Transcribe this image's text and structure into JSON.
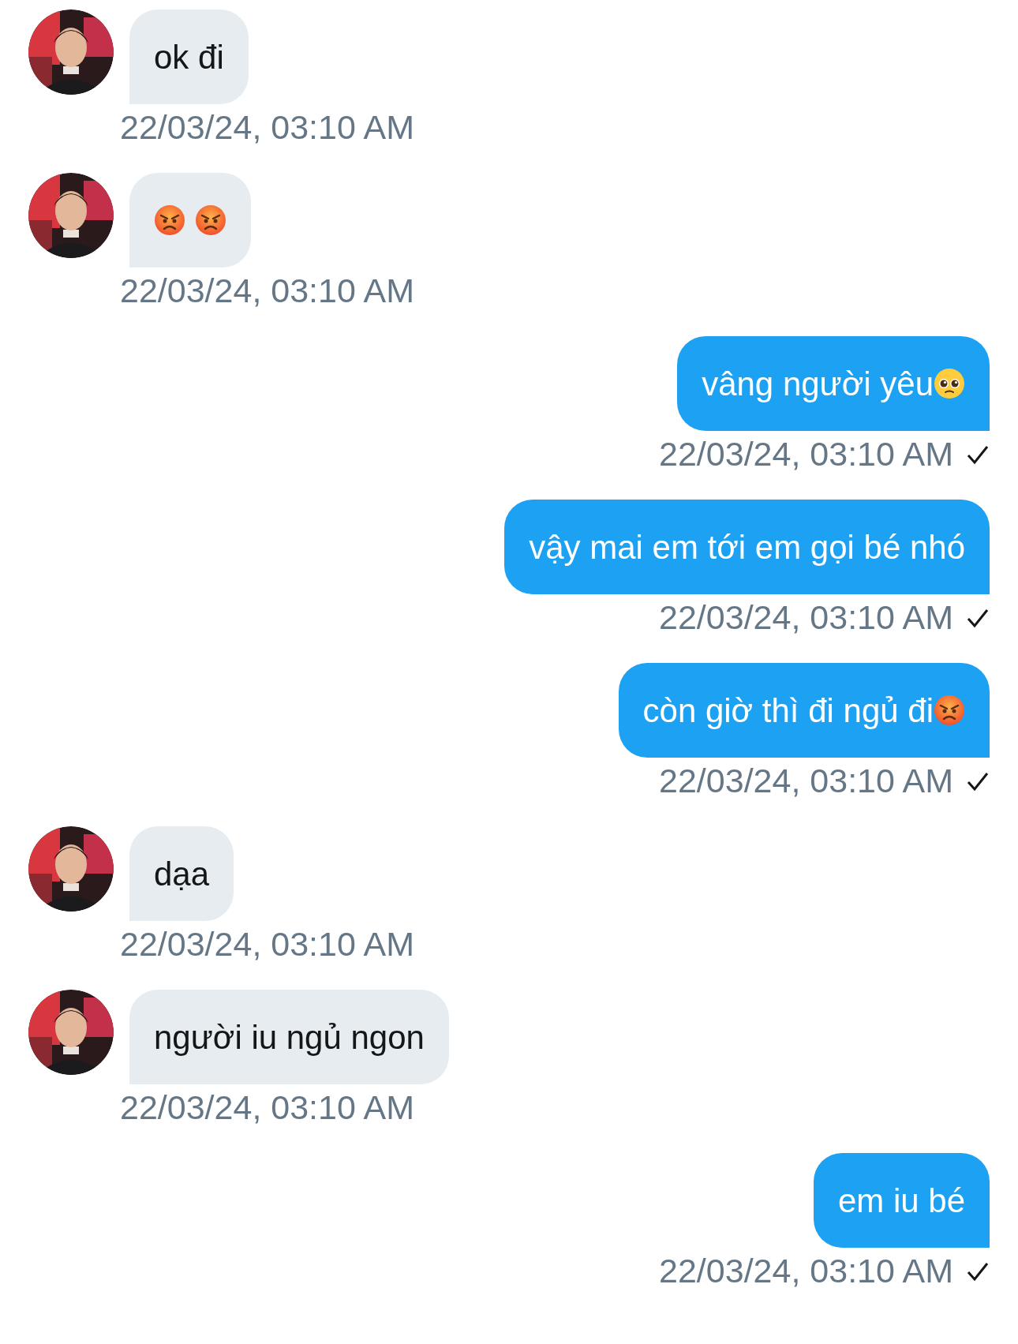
{
  "messages": [
    {
      "kind": "incoming",
      "text": "ok đi",
      "time": "22/03/24, 03:10 AM"
    },
    {
      "kind": "incoming",
      "emojis": [
        {
          "kind": "angry"
        },
        {
          "kind": "angry"
        }
      ],
      "time": "22/03/24, 03:10 AM"
    },
    {
      "kind": "outgoing",
      "text": "vâng người yêu",
      "emojis": [
        {
          "kind": "pleading"
        }
      ],
      "time": "22/03/24, 03:10 AM",
      "sent": true
    },
    {
      "kind": "outgoing",
      "text": "vậy mai em tới em gọi bé nhó",
      "time": "22/03/24, 03:10 AM",
      "sent": true
    },
    {
      "kind": "outgoing",
      "text": "còn giờ thì đi ngủ đi",
      "emojis": [
        {
          "kind": "angry"
        }
      ],
      "time": "22/03/24, 03:10 AM",
      "sent": true
    },
    {
      "kind": "incoming",
      "text": "dạa",
      "time": "22/03/24, 03:10 AM"
    },
    {
      "kind": "incoming",
      "text": "người iu ngủ ngon",
      "time": "22/03/24, 03:10 AM"
    },
    {
      "kind": "outgoing",
      "text": "em iu bé",
      "time": "22/03/24, 03:10 AM",
      "sent": true
    }
  ]
}
